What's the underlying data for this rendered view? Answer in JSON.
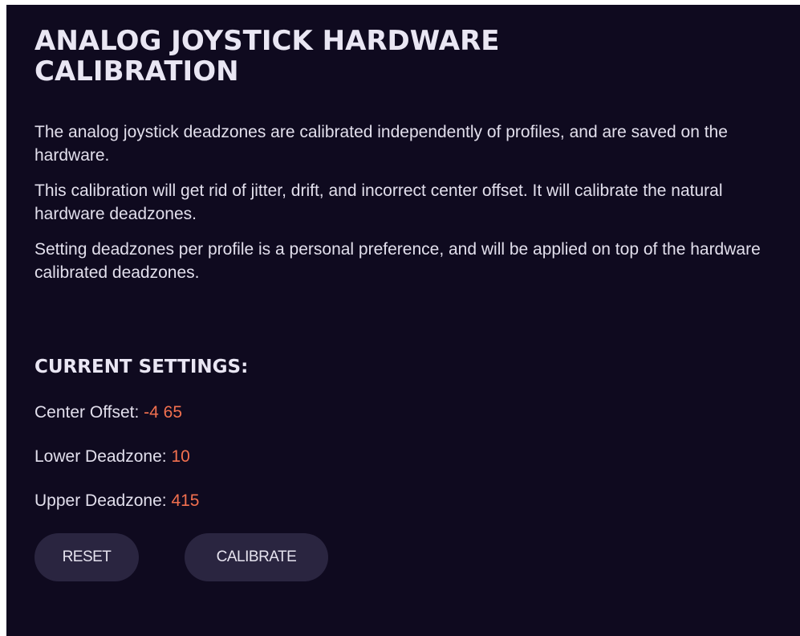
{
  "panel": {
    "title": "ANALOG JOYSTICK HARDWARE CALIBRATION",
    "paragraphs": [
      "The analog joystick deadzones are calibrated independently of profiles, and are saved on the hardware.",
      "This calibration will get rid of jitter, drift, and incorrect center offset. It will calibrate the natural hardware deadzones.",
      "Setting deadzones per profile is a personal preference, and will be applied on top of the hardware calibrated deadzones."
    ]
  },
  "settings": {
    "heading": "CURRENT SETTINGS:",
    "items": [
      {
        "label": "Center Offset: ",
        "value": "-4 65"
      },
      {
        "label": "Lower Deadzone: ",
        "value": "10"
      },
      {
        "label": "Upper Deadzone: ",
        "value": "415"
      }
    ]
  },
  "actions": {
    "reset_label": "RESET",
    "calibrate_label": "CALIBRATE"
  },
  "colors": {
    "background": "#0f0a1f",
    "text": "#e2dfec",
    "accent_value": "#f2704f",
    "button_bg": "#2a2540"
  }
}
